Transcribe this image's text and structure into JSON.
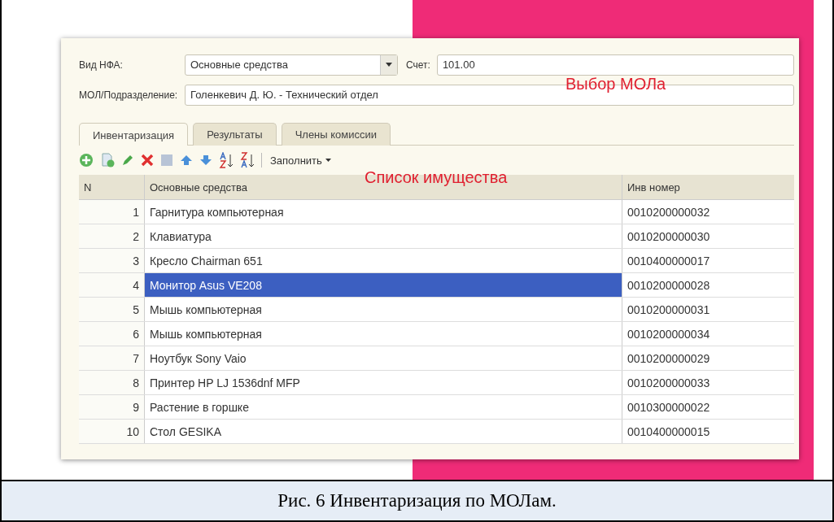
{
  "form": {
    "fields": [
      {
        "label": "Вид НФА:",
        "value": "Основные средства",
        "kind": "dropdown"
      },
      {
        "label": "Счет:",
        "value": "101.00",
        "kind": "text"
      },
      {
        "label": "МОЛ/Подразделение:",
        "value": "Голенкевич Д. Ю. - Технический отдел",
        "kind": "text"
      }
    ],
    "tabs": [
      {
        "label": "Инвентаризация",
        "selected": true
      },
      {
        "label": "Результаты",
        "selected": false
      },
      {
        "label": "Члены комиссии",
        "selected": false
      }
    ],
    "toolbar": {
      "fill_button": "Заполнить"
    },
    "table": {
      "columns": [
        "N",
        "Основные средства",
        "Инв номер"
      ],
      "rows": [
        {
          "n": "1",
          "name": "Гарнитура компьютерная",
          "inv": "0010200000032",
          "selected": false
        },
        {
          "n": "2",
          "name": "Клавиатура",
          "inv": "0010200000030",
          "selected": false
        },
        {
          "n": "3",
          "name": "Кресло Chairman 651",
          "inv": "0010400000017",
          "selected": false
        },
        {
          "n": "4",
          "name": "Монитор Asus VE208",
          "inv": "0010200000028",
          "selected": true
        },
        {
          "n": "5",
          "name": "Мышь компьютерная",
          "inv": "0010200000031",
          "selected": false
        },
        {
          "n": "6",
          "name": "Мышь компьютерная",
          "inv": "0010200000034",
          "selected": false
        },
        {
          "n": "7",
          "name": "Ноутбук Sony Vaio",
          "inv": "0010200000029",
          "selected": false
        },
        {
          "n": "8",
          "name": "Принтер HP LJ 1536dnf MFP",
          "inv": "0010200000033",
          "selected": false
        },
        {
          "n": "9",
          "name": "Растение в горшке",
          "inv": "0010300000022",
          "selected": false
        },
        {
          "n": "10",
          "name": "Стол GESIKA",
          "inv": "0010400000015",
          "selected": false
        }
      ]
    }
  },
  "annotations": [
    "Выбор МОЛа",
    "Список имущества"
  ],
  "caption": "Рис. 6 Инвентаризация по МОЛам."
}
